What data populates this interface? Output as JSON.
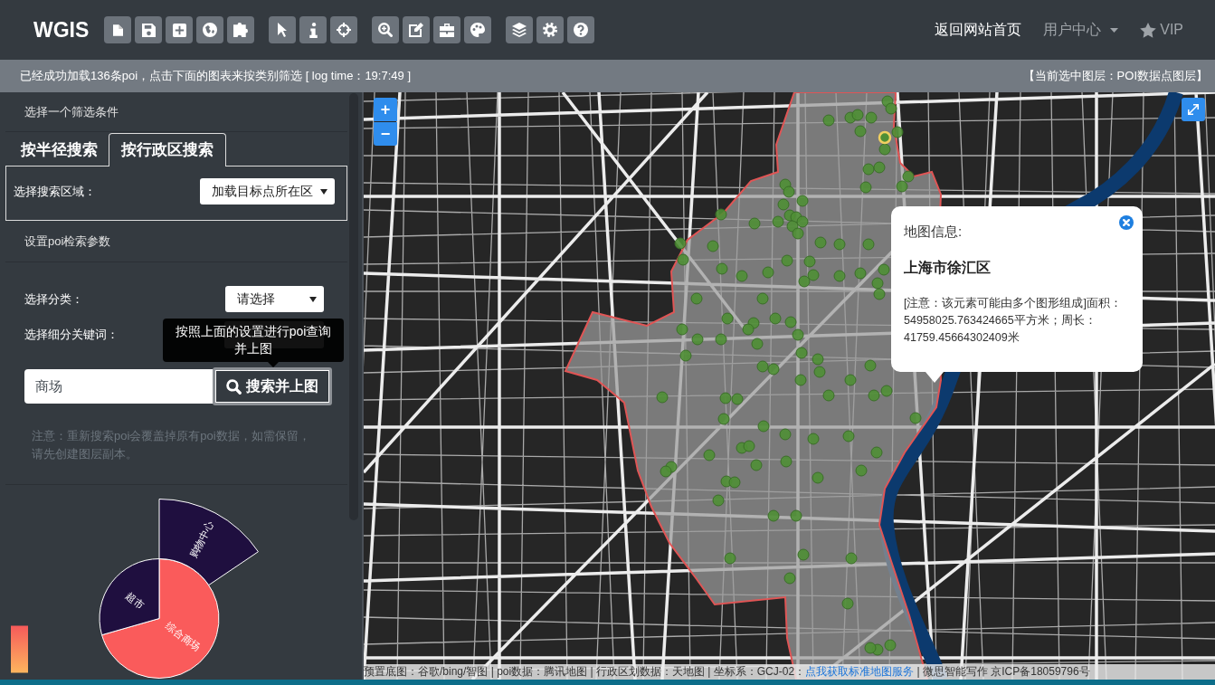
{
  "header": {
    "logo": "WGIS",
    "nav": [
      {
        "label": "返回网站首页",
        "kind": "link",
        "active": true
      },
      {
        "label": "用户中心",
        "kind": "dropdown",
        "active": false
      },
      {
        "label": "VIP",
        "kind": "starred",
        "active": false
      }
    ]
  },
  "info_bar": {
    "message": "已经成功加载136条poi，点击下面的图表来按类别筛选 [ log time：19:7:49 ]",
    "current_layer": "【当前选中图层：POI数据点图层】"
  },
  "sidebar": {
    "filter_heading": "选择一个筛选条件",
    "tabs": [
      {
        "label": "按半径搜索",
        "selected": false
      },
      {
        "label": "按行政区搜索",
        "selected": true
      }
    ],
    "area_label": "选择搜索区域：",
    "area_select": "加载目标点所在区",
    "params_heading": "设置poi检索参数",
    "category_label": "选择分类：",
    "category_select": "请选择",
    "keyword_label": "选择细分关键词：",
    "tooltip": "按照上面的设置进行poi查询并上图",
    "search_input": {
      "value": "商场"
    },
    "search_button": "搜索并上图",
    "note": "注意：重新搜索poi会覆盖掉原有poi数据，如需保留，请先创建图层副本。",
    "chart": {
      "slices": [
        {
          "label": "综合商场",
          "color": "#fa5b5b"
        },
        {
          "label": "超市",
          "color": "#1f0f3f"
        },
        {
          "label": "购物中心",
          "color": "#1f0f3f"
        }
      ]
    }
  },
  "map": {
    "zoom_in": "+",
    "zoom_out": "−",
    "popup": {
      "title": "地图信息:",
      "heading": "上海市徐汇区",
      "body": "[注意：该元素可能由多个图形组成]面积：54958025.763424665平方米；周长：41759.45664302409米"
    },
    "attribution": {
      "before": "预置底图：谷歌/bing/智图 | poi数据：腾讯地图 | 行政区划数据：天地图 | 坐标系：GCJ-02：",
      "link": "点我获取标准地图服务",
      "after": " | 微思智能写作 京ICP备18059796号"
    }
  }
}
